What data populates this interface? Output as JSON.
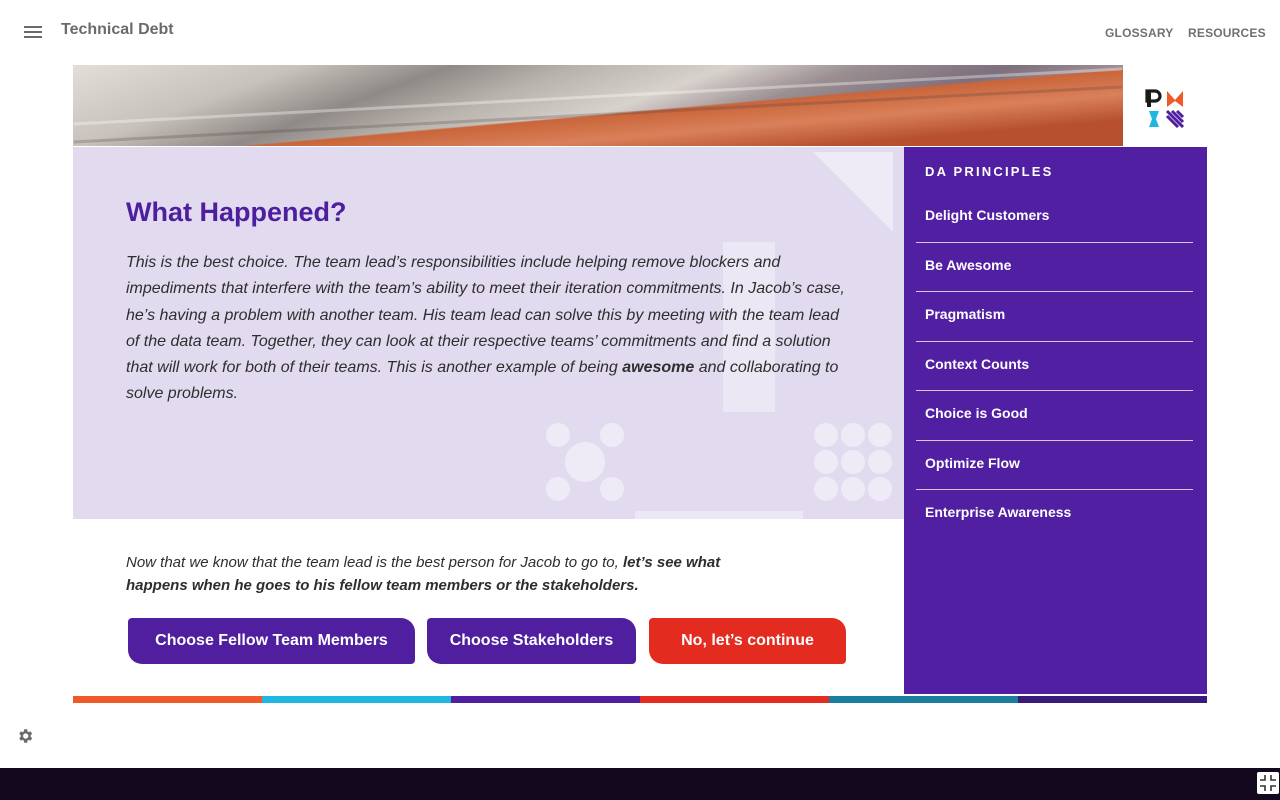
{
  "header": {
    "title": "Technical Debt",
    "nav": [
      "GLOSSARY",
      "RESOURCES"
    ]
  },
  "main": {
    "heading": "What Happened?",
    "body_before_bold": "This is the best choice. The team lead’s responsibilities include helping remove blockers and impediments that interfere with the team’s ability to meet their iteration commitments. In Jacob’s case, he’s having a problem with another team. His team lead can solve this by meeting with the team lead of the data team. Together, they can look at their respective teams’ commitments and find a solution that will work for both of their teams. This is another example of being ",
    "body_bold": "awesome",
    "body_after_bold": " and collaborating to solve problems.",
    "prompt_plain": "Now that we know that the team lead is the best person for Jacob to go to, ",
    "prompt_bold": "let’s see what happens when he goes to his fellow team members or the stakeholders."
  },
  "buttons": {
    "fellow_team": "Choose Fellow Team Members",
    "stakeholders": "Choose Stakeholders",
    "continue": "No, let’s continue"
  },
  "sidebar": {
    "title": "DA PRINCIPLES",
    "items": [
      "Delight Customers",
      "Be Awesome",
      "Pragmatism",
      "Context Counts",
      "Choice is Good",
      "Optimize Flow",
      "Enterprise Awareness"
    ]
  },
  "colors": {
    "accent_purple": "#511fa1",
    "accent_red": "#e32b1f",
    "panel_bg": "#e2daef",
    "color_bar": [
      "#f05a28",
      "#1fb6e0",
      "#4f1fa0",
      "#e32b1f",
      "#1a7e9e",
      "#3b1a7c"
    ]
  },
  "icons": {
    "menu": "hamburger-icon",
    "settings": "gear-icon",
    "fullscreen": "exit-fullscreen-icon"
  }
}
